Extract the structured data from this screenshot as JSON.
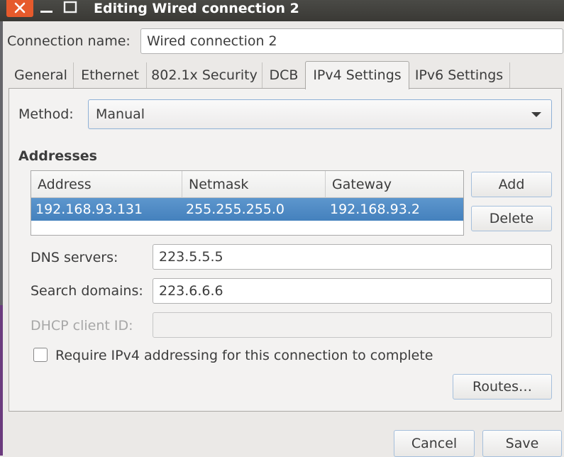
{
  "window": {
    "title": "Editing Wired connection 2"
  },
  "connection_name": {
    "label": "Connection name:",
    "value": "Wired connection 2"
  },
  "tabs": [
    {
      "label": "General"
    },
    {
      "label": "Ethernet"
    },
    {
      "label": "802.1x Security"
    },
    {
      "label": "DCB"
    },
    {
      "label": "IPv4 Settings",
      "active": true
    },
    {
      "label": "IPv6 Settings"
    }
  ],
  "method": {
    "label": "Method:",
    "value": "Manual"
  },
  "addresses": {
    "heading": "Addresses",
    "columns": [
      "Address",
      "Netmask",
      "Gateway"
    ],
    "rows": [
      {
        "address": "192.168.93.131",
        "netmask": "255.255.255.0",
        "gateway": "192.168.93.2",
        "selected": true
      }
    ],
    "add_label": "Add",
    "delete_label": "Delete"
  },
  "dns_servers": {
    "label": "DNS servers:",
    "value": "223.5.5.5"
  },
  "search_domains": {
    "label": "Search domains:",
    "value": "223.6.6.6"
  },
  "dhcp_client_id": {
    "label": "DHCP client ID:",
    "value": "",
    "enabled": false
  },
  "require_ipv4": {
    "label": "Require IPv4 addressing for this connection to complete",
    "checked": false
  },
  "routes_label": "Routes…",
  "footer": {
    "cancel_label": "Cancel",
    "save_label": "Save"
  },
  "colors": {
    "titlebar": "#3c3b37",
    "close_button": "#e65a2c",
    "selection": "#4a86c1",
    "focus_border": "#8fb1d6"
  }
}
